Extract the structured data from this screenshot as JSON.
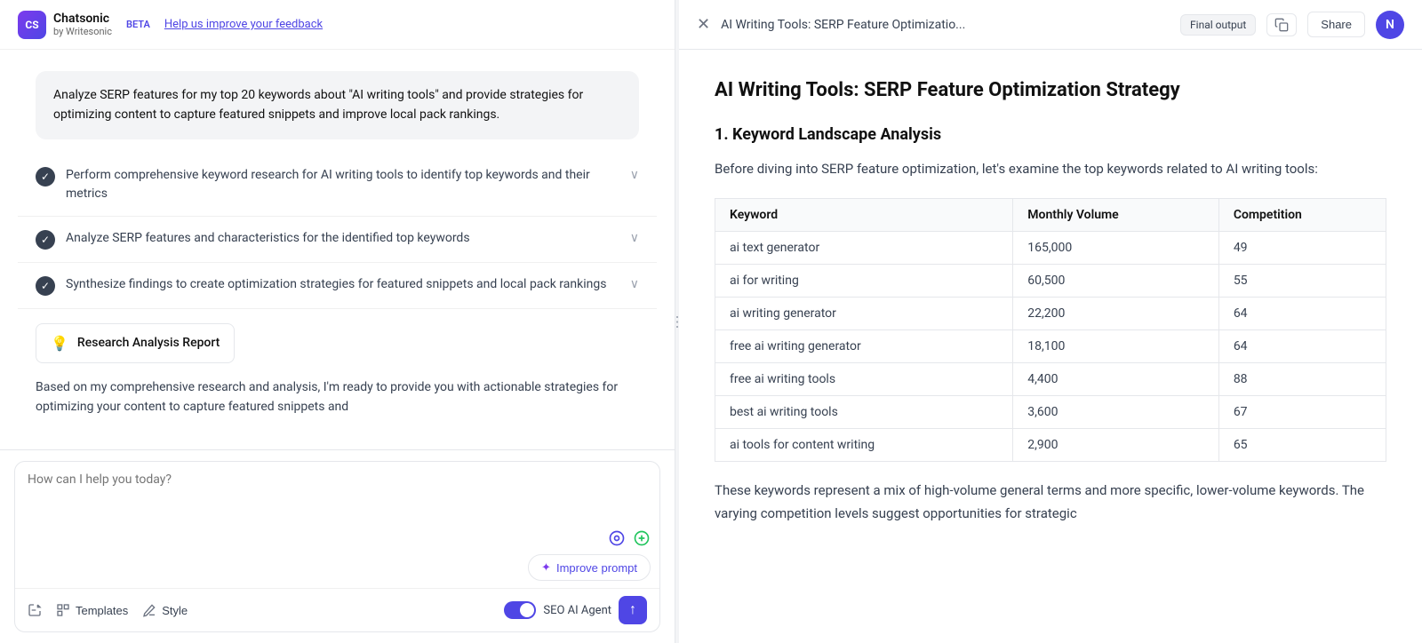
{
  "app": {
    "logo_initials": "CS",
    "app_name": "Chatsonic",
    "app_sub": "by Writesonic",
    "beta_label": "BETA",
    "feedback_link": "Help us improve your feedback"
  },
  "chat": {
    "user_message": "Analyze SERP features for my top 20 keywords about \"AI writing tools\" and provide strategies for optimizing content to capture featured snippets and improve local pack rankings.",
    "tasks": [
      {
        "text": "Perform comprehensive keyword research for AI writing tools to identify top keywords and their metrics",
        "done": true
      },
      {
        "text": "Analyze SERP features and characteristics for the identified top keywords",
        "done": true
      },
      {
        "text": "Synthesize findings to create optimization strategies for featured snippets and local pack rankings",
        "done": true
      }
    ],
    "report_card_label": "Research Analysis Report",
    "analysis_text": "Based on my comprehensive research and analysis, I'm ready to provide you with actionable strategies for optimizing your content to capture featured snippets and"
  },
  "input": {
    "placeholder": "How can I help you today?",
    "templates_label": "Templates",
    "style_label": "Style",
    "improve_prompt_label": "Improve prompt",
    "seo_agent_label": "SEO AI Agent",
    "send_icon": "↑"
  },
  "right_panel": {
    "doc_title": "AI Writing Tools: SERP Feature Optimizatio...",
    "final_output_label": "Final output",
    "share_label": "Share",
    "avatar_initial": "N",
    "doc_heading": "AI Writing Tools: SERP Feature Optimization Strategy",
    "section1_heading": "1. Keyword Landscape Analysis",
    "intro_text": "Before diving into SERP feature optimization, let's examine the top keywords related to AI writing tools:",
    "table": {
      "headers": [
        "Keyword",
        "Monthly Volume",
        "Competition"
      ],
      "rows": [
        [
          "ai text generator",
          "165,000",
          "49"
        ],
        [
          "ai for writing",
          "60,500",
          "55"
        ],
        [
          "ai writing generator",
          "22,200",
          "64"
        ],
        [
          "free ai writing generator",
          "18,100",
          "64"
        ],
        [
          "free ai writing tools",
          "4,400",
          "88"
        ],
        [
          "best ai writing tools",
          "3,600",
          "67"
        ],
        [
          "ai tools for content writing",
          "2,900",
          "65"
        ]
      ]
    },
    "outro_text": "These keywords represent a mix of high-volume general terms and more specific, lower-volume keywords. The varying competition levels suggest opportunities for strategic"
  }
}
